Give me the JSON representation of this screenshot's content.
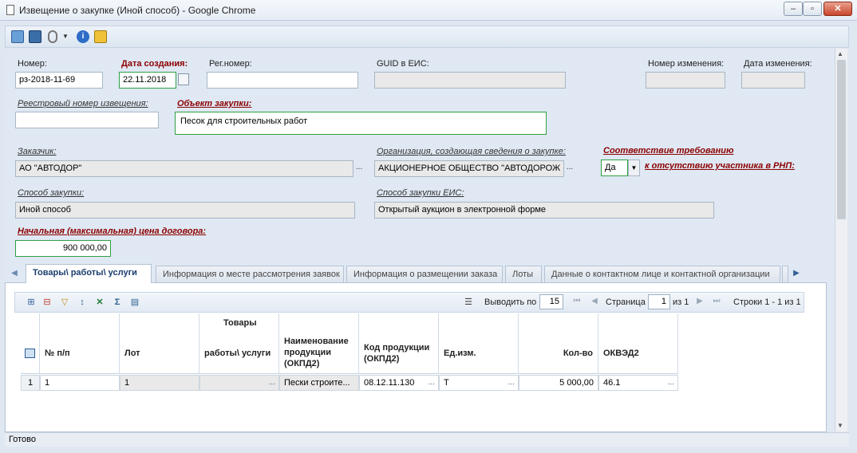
{
  "window": {
    "title": "Извещение о закупке (Иной способ) - Google Chrome",
    "minimize": "‒",
    "restore": "▫",
    "close": "✕"
  },
  "form": {
    "number_label": "Номер:",
    "number_value": "рз-2018-11-69",
    "created_label": "Дата создания:",
    "created_value": "22.11.2018",
    "regnum_label": "Рег.номер:",
    "regnum_value": "",
    "guid_label": "GUID в ЕИС:",
    "guid_value": "",
    "change_num_label": "Номер изменения:",
    "change_num_value": "",
    "change_date_label": "Дата изменения:",
    "change_date_value": "",
    "registry_num_label": "Реестровый номер извещения:",
    "registry_num_value": "",
    "object_label": "Объект закупки:",
    "object_value": "Песок для строительных работ",
    "customer_label": "Заказчик:",
    "customer_value": "АО \"АВТОДОР\"",
    "org_label": "Организация, создающая сведения о закупке:",
    "org_value": "АКЦИОНЕРНОЕ ОБЩЕСТВО \"АВТОДОРОЖ",
    "rnp_label_1": "Соответствие требованию",
    "rnp_label_2": "к отсутствию участника в РНП:",
    "rnp_value": "Да",
    "method_label": "Способ закупки:",
    "method_value": "Иной способ",
    "method_eis_label": "Способ закупки ЕИС:",
    "method_eis_value": "Открытый аукцион в электронной форме",
    "price_label": "Начальная (максимальная) цена договора:",
    "price_value": "900 000,00",
    "dots": "..."
  },
  "tabs": [
    {
      "label": "Товары\\ работы\\ услуги"
    },
    {
      "label": "Информация о месте рассмотрения заявок"
    },
    {
      "label": "Информация о размещении заказа"
    },
    {
      "label": "Лоты"
    },
    {
      "label": "Данные о контактном лице и контактной организации"
    }
  ],
  "pager": {
    "show_label": "Выводить по",
    "page_size": "15",
    "page_label": "Страница",
    "page_value": "1",
    "of_label": "из 1",
    "rows_label": "Строки 1 - 1 из 1"
  },
  "grid": {
    "headers": {
      "num": "№ п/п",
      "lot": "Лот",
      "goods_top": "Товары",
      "goods_bottom": "работы\\ услуги",
      "name": "Наименование продукции (ОКПД2)",
      "code": "Код продукции (ОКПД2)",
      "unit": "Ед.изм.",
      "qty": "Кол-во",
      "okved": "ОКВЭД2"
    },
    "rows": [
      {
        "idx": "1",
        "num": "1",
        "lot": "1",
        "goods": "",
        "name": "Пески строите...",
        "code": "08.12.11.130",
        "unit": "Т",
        "qty": "5 000,00",
        "okved": "46.1"
      }
    ]
  },
  "status": "Готово"
}
